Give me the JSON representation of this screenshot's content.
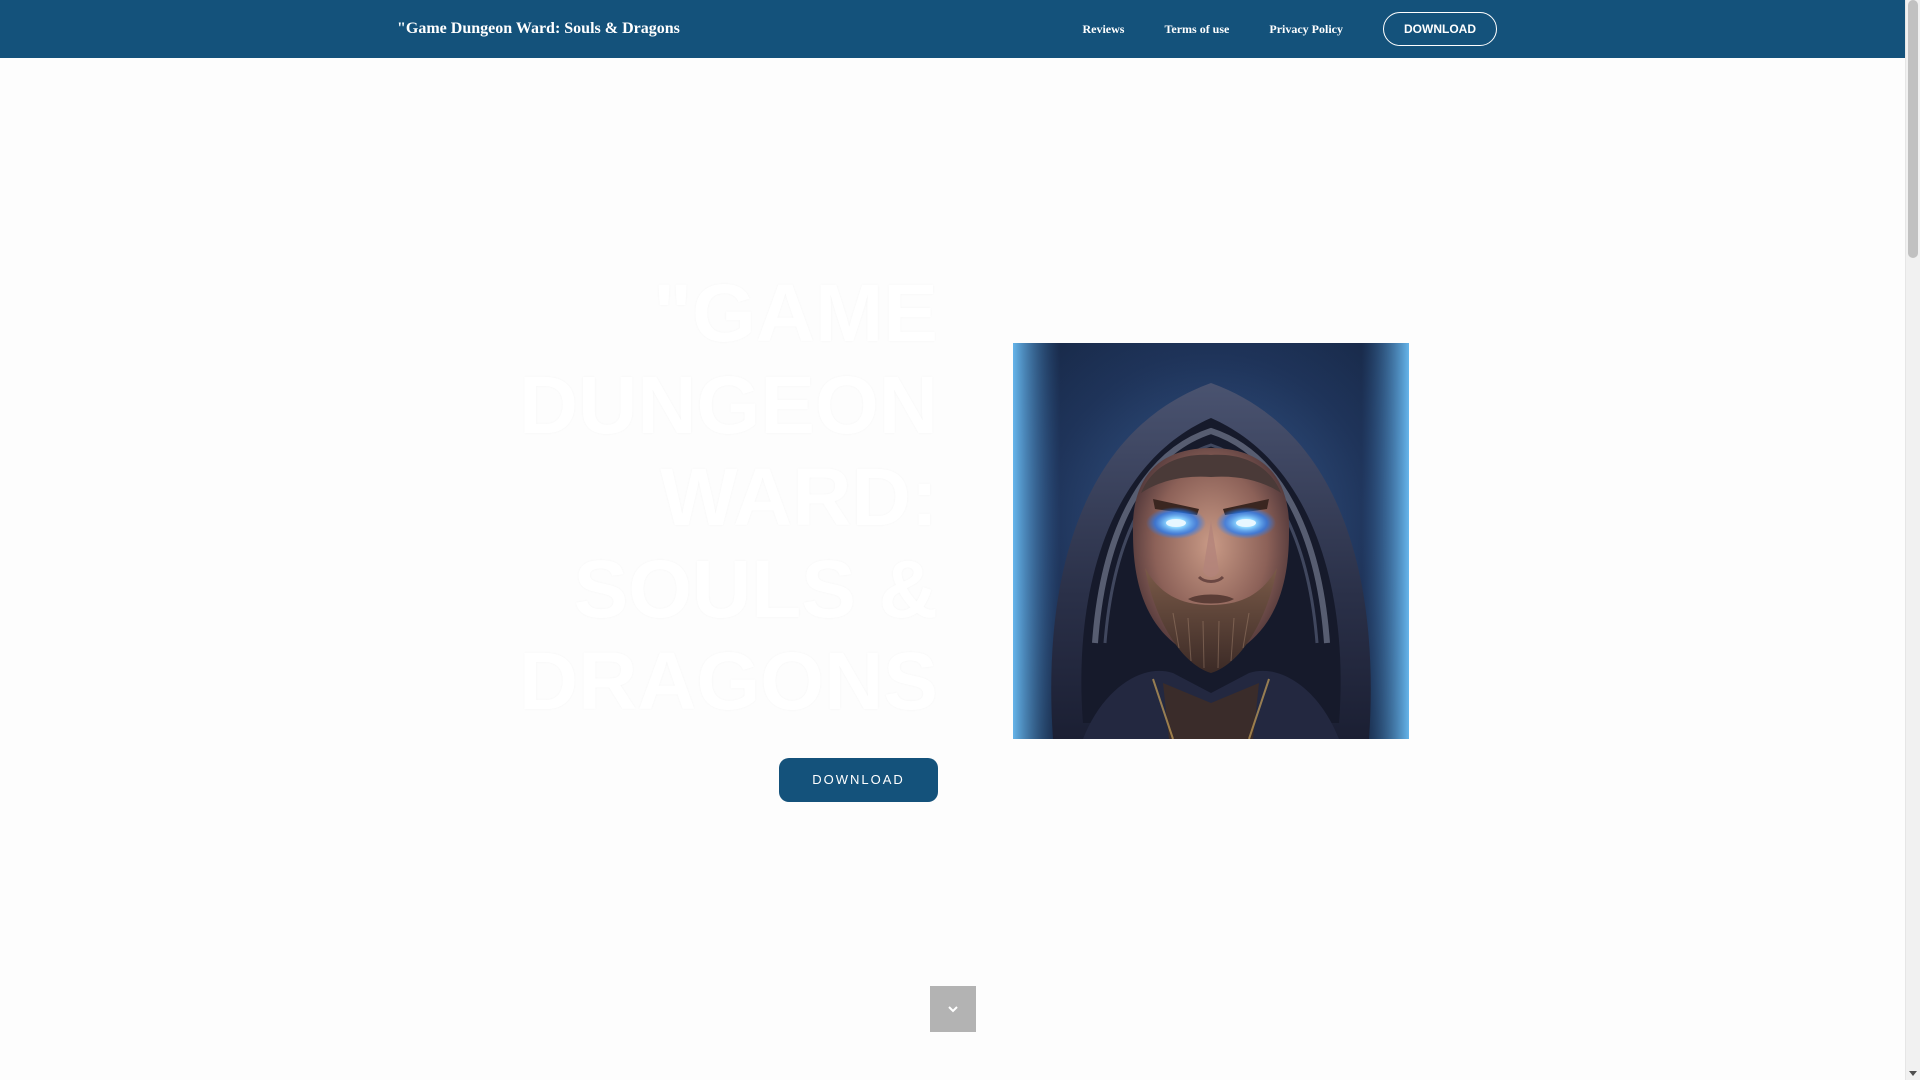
{
  "navbar": {
    "brand": "\"Game Dungeon Ward: Souls & Dragons",
    "links": [
      {
        "label": "Reviews"
      },
      {
        "label": "Terms of use"
      },
      {
        "label": "Privacy Policy"
      }
    ],
    "download_label": "DOWNLOAD"
  },
  "hero": {
    "title": "\"Game Dungeon Ward: Souls & Dragons",
    "download_label": "DOWNLOAD",
    "image_icon": "hooded-warrior-portrait"
  },
  "scroll_down": {
    "icon": "chevron-down-icon"
  },
  "colors": {
    "primary": "#14527b",
    "scroll_button": "#b3b3b3",
    "background": "#fdfdfd"
  }
}
